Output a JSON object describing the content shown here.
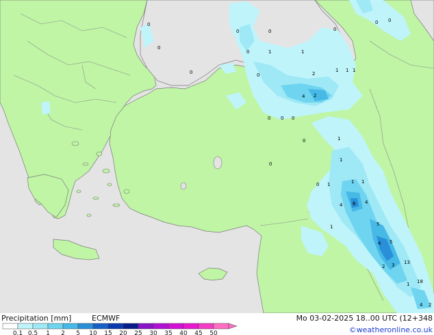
{
  "header": {
    "title": "Precipitation [mm]",
    "model": "ECMWF",
    "datetime": "Mo 03-02-2025 18..00 UTC (12+348",
    "credit": "©weatheronline.co.uk"
  },
  "legend": {
    "ticks": [
      "0.1",
      "0.5",
      "1",
      "2",
      "5",
      "10",
      "15",
      "20",
      "25",
      "30",
      "35",
      "40",
      "45",
      "50"
    ],
    "colors": [
      "#ffffff",
      "#bff4fb",
      "#9fe8f6",
      "#6fd4ef",
      "#46b9e6",
      "#2a8fd9",
      "#1760c8",
      "#0b3ab0",
      "#081c8a",
      "#8a12c9",
      "#b10fd3",
      "#d40fd6",
      "#e818cf",
      "#f43cc4",
      "#fb6ec3"
    ]
  },
  "colors": {
    "land": "#bff5a5",
    "sea": "#e4e4e4",
    "border": "#8c8c8c",
    "coast": "#7a7a7a"
  },
  "precip_values": [
    "0",
    "0",
    "0",
    "0",
    "0",
    "0",
    "0",
    "0",
    "0",
    "1",
    "1",
    "1",
    "2",
    "1",
    "1",
    "0",
    "4",
    "2",
    "0",
    "0",
    "0",
    "0",
    "0",
    "1",
    "1",
    "0",
    "1",
    "1",
    "1",
    "4",
    "8",
    "4",
    "1",
    "5",
    "4",
    "5",
    "13",
    "3",
    "2",
    "1",
    "18",
    "4",
    "2"
  ]
}
